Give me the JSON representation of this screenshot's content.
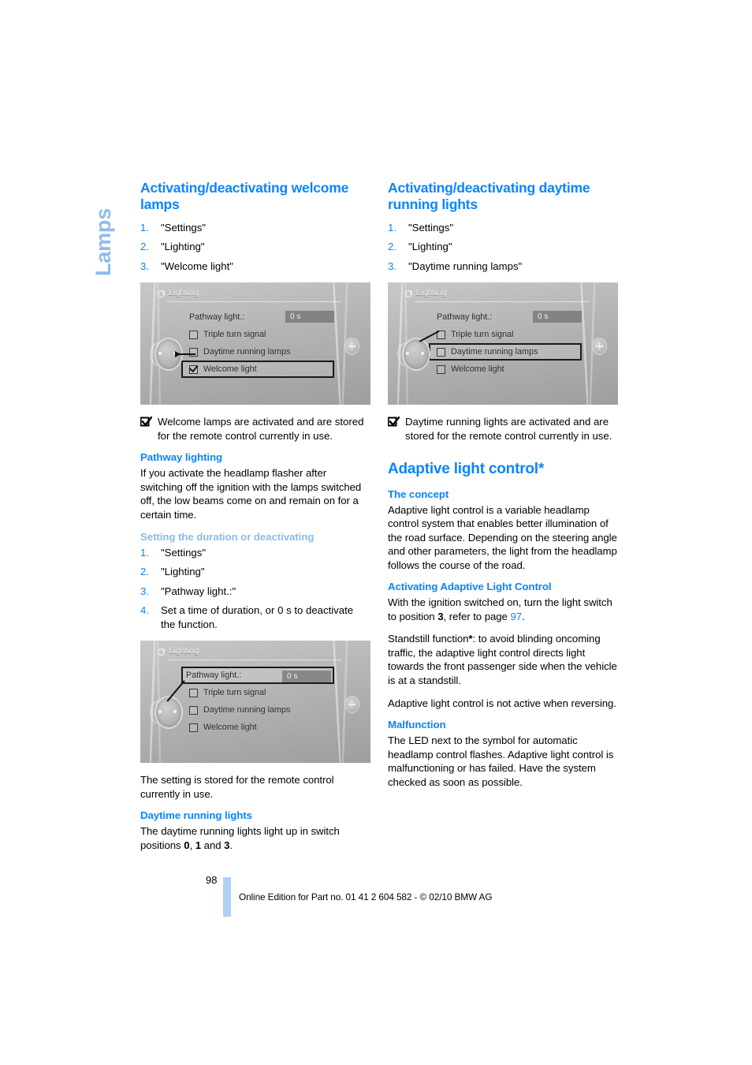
{
  "chapter": {
    "label": "Lamps"
  },
  "folio": {
    "page_number": "98"
  },
  "footer": {
    "text": "Online Edition for Part no. 01 41 2 604 582 - © 02/10 BMW AG"
  },
  "left_column": {
    "section_welcome": {
      "heading": "Activating/deactivating welcome lamps",
      "steps": [
        "\"Settings\"",
        "\"Lighting\"",
        "\"Welcome light\""
      ],
      "note": "Welcome lamps are activated and are stored for the remote control currently in use.",
      "note_icon": "checkbox-checked-icon"
    },
    "section_pathway": {
      "heading": "Pathway lighting",
      "body": "If you activate the headlamp flasher after switching off the ignition with the lamps switched off, the low beams come on and remain on for a certain time."
    },
    "section_duration": {
      "heading": "Setting the duration or deactivating",
      "steps": [
        "\"Settings\"",
        "\"Lighting\"",
        "\"Pathway light.:\"",
        "Set a time of duration, or 0 s to deactivate the function."
      ],
      "after_image_text": "The setting is stored for the remote control currently in use."
    },
    "section_drl": {
      "heading": "Daytime running lights",
      "body_prefix": "The daytime running lights light up in switch positions ",
      "pos_0": "0",
      "pos_sep1": ", ",
      "pos_1": "1",
      "pos_sep2": " and ",
      "pos_3": "3",
      "body_suffix": "."
    }
  },
  "right_column": {
    "section_drl_toggle": {
      "heading": "Activating/deactivating daytime running lights",
      "steps": [
        "\"Settings\"",
        "\"Lighting\"",
        "\"Daytime running lamps\""
      ],
      "note": "Daytime running lights are activated and are stored for the remote control currently in use.",
      "note_icon": "checkbox-checked-icon"
    },
    "section_alc": {
      "heading": "Adaptive light control*",
      "concept_heading": "The concept",
      "concept_body": "Adaptive light control is a variable headlamp control system that enables better illumination of the road surface. Depending on the steering angle and other parameters, the light from the headlamp follows the course of the road.",
      "activating_heading": "Activating Adaptive Light Control",
      "activating_p1_a": "With the ignition switched on, turn the light switch to position ",
      "activating_p1_pos": "3",
      "activating_p1_b": ", refer to page ",
      "activating_p1_pageref": "97",
      "activating_p1_c": ".",
      "activating_p2_a": "Standstill function",
      "activating_p2_star": "*",
      "activating_p2_b": ": to avoid blinding oncoming traffic, the adaptive light control directs light towards the front passenger side when the vehicle is at a standstill.",
      "activating_p3": "Adaptive light control is not active when reversing.",
      "malfunction_heading": "Malfunction",
      "malfunction_body": "The LED next to the symbol for automatic headlamp control flashes. Adaptive light control is malfunctioning or has failed. Have the system checked as soon as possible."
    }
  },
  "idrive_screens": [
    {
      "id": "welcome-light-selected",
      "title": "Lighting",
      "title_icon": "lighting-menu-icon",
      "pathway_label": "Pathway light.:",
      "pathway_value": "0 s",
      "rows": [
        {
          "label": "Triple turn signal",
          "checked": false,
          "selected": false
        },
        {
          "label": "Daytime running lamps",
          "checked": false,
          "selected": false
        },
        {
          "label": "Welcome light",
          "checked": true,
          "selected": true
        }
      ],
      "selected_row_index": 2,
      "pathway_selected": false
    },
    {
      "id": "daytime-running-lamps-selected",
      "title": "Lighting",
      "title_icon": "lighting-menu-icon",
      "pathway_label": "Pathway light.:",
      "pathway_value": "0 s",
      "rows": [
        {
          "label": "Triple turn signal",
          "checked": false,
          "selected": false
        },
        {
          "label": "Daytime running lamps",
          "checked": false,
          "selected": true
        },
        {
          "label": "Welcome light",
          "checked": false,
          "selected": false
        }
      ],
      "selected_row_index": 1,
      "pathway_selected": false
    },
    {
      "id": "pathway-light-selected",
      "title": "Lighting",
      "title_icon": "lighting-menu-icon",
      "pathway_label": "Pathway light.:",
      "pathway_value": "0 s",
      "rows": [
        {
          "label": "Triple turn signal",
          "checked": false,
          "selected": false
        },
        {
          "label": "Daytime running lamps",
          "checked": false,
          "selected": false
        },
        {
          "label": "Welcome light",
          "checked": false,
          "selected": false
        }
      ],
      "selected_row_index": -1,
      "pathway_selected": true
    }
  ],
  "colors": {
    "heading_blue": "#0A84FF",
    "heading_light_blue": "#8CBBEF",
    "folio_bar": "#AFD0F5",
    "text": "#000000"
  }
}
